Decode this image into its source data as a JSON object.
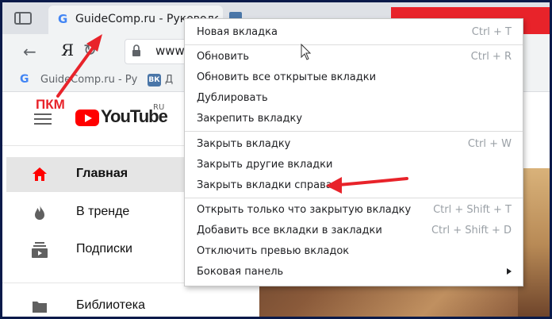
{
  "tabs": [
    {
      "favicon": "G",
      "title": "GuideComp.ru - Руководство"
    }
  ],
  "toolbar": {
    "back_icon": "←",
    "yandex_logo": "Я",
    "reload_icon": "↻",
    "url": "www"
  },
  "bookmarks": {
    "items": [
      {
        "favicon": "G",
        "label": "GuideComp.ru - Ру"
      },
      {
        "favicon": "ВК",
        "label": "Д"
      }
    ]
  },
  "annotation": {
    "label": "ПКМ",
    "color": "#e8232a"
  },
  "youtube": {
    "logo_text": "YouTube",
    "region": "RU",
    "sidebar": [
      {
        "label": "Главная",
        "icon": "home-icon",
        "active": true
      },
      {
        "label": "В тренде",
        "icon": "flame-icon",
        "active": false
      },
      {
        "label": "Подписки",
        "icon": "subscriptions-icon",
        "active": false
      },
      {
        "label": "Библиотека",
        "icon": "library-icon",
        "active": false
      }
    ]
  },
  "context_menu": {
    "items": [
      {
        "label": "Новая вкладка",
        "shortcut": "Ctrl + T"
      },
      {
        "label": "Обновить",
        "shortcut": "Ctrl + R"
      },
      {
        "label": "Обновить все открытые вкладки",
        "shortcut": ""
      },
      {
        "label": "Дублировать",
        "shortcut": ""
      },
      {
        "label": "Закрепить вкладку",
        "shortcut": ""
      },
      {
        "label": "Закрыть вкладку",
        "shortcut": "Ctrl + W"
      },
      {
        "label": "Закрыть другие вкладки",
        "shortcut": ""
      },
      {
        "label": "Закрыть вкладки справа",
        "shortcut": ""
      },
      {
        "label": "Открыть только что закрытую вкладку",
        "shortcut": "Ctrl + Shift + T"
      },
      {
        "label": "Добавить все вкладки в закладки",
        "shortcut": "Ctrl + Shift + D"
      },
      {
        "label": "Отключить превью вкладок",
        "shortcut": ""
      },
      {
        "label": "Боковая панель",
        "shortcut": "",
        "submenu": true
      }
    ]
  },
  "colors": {
    "accent_red": "#e8232a",
    "youtube_red": "#ff0000",
    "menu_border": "#c8c8c8"
  }
}
